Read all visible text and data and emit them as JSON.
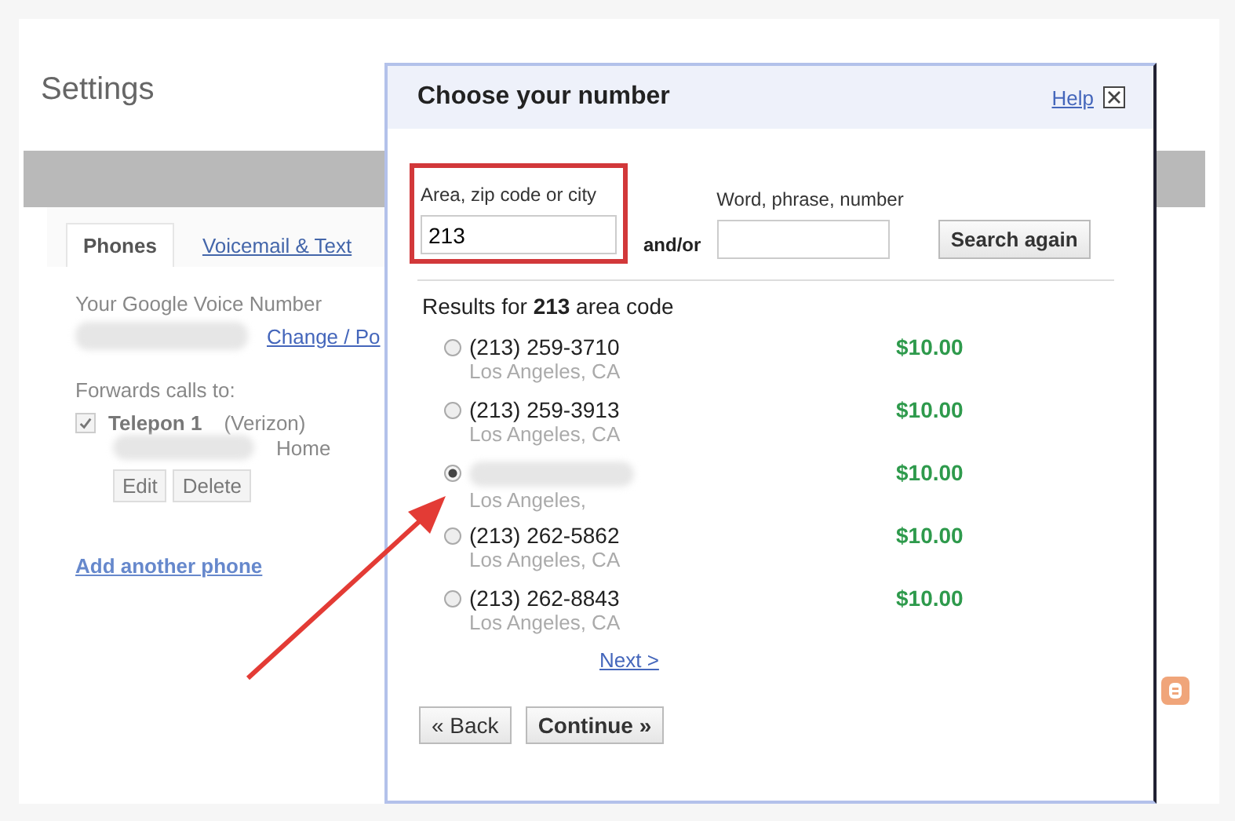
{
  "settings": {
    "title": "Settings",
    "tabs": [
      {
        "label": "Phones",
        "selected": true
      },
      {
        "label": "Voicemail & Text",
        "selected": false
      }
    ],
    "number_label": "Your Google Voice Number",
    "change_link": "Change / Po",
    "forwards_label": "Forwards calls to:",
    "phones": [
      {
        "name": "Telepon 1",
        "carrier": "(Verizon)",
        "type": "Home",
        "checked": true
      }
    ],
    "edit_button": "Edit",
    "delete_button": "Delete",
    "add_link": "Add another phone"
  },
  "dialog": {
    "title": "Choose your number",
    "help": "Help",
    "area_label": "Area, zip code or city",
    "area_value": "213",
    "and_or": "and/or",
    "word_label": "Word, phrase, number",
    "search_button": "Search again",
    "results": "Results for **213** area code",
    "numbers": [
      {
        "number": "(213) 259-3710",
        "city": "Los Angeles, CA",
        "price": "$10.00",
        "selected": false
      },
      {
        "number": "(213) 259-3913",
        "city": "Los Angeles, CA",
        "price": "$10.00",
        "selected": false
      },
      {
        "city": "Los Angeles,",
        "price": "$10.00",
        "selected": true
      },
      {
        "number": "(213) 262-5862",
        "city": "Los Angeles, CA",
        "price": "$10.00",
        "selected": false
      },
      {
        "number": "(213) 262-8843",
        "city": "Los Angeles, CA",
        "price": "$10.00",
        "selected": false
      }
    ],
    "next": "Next >",
    "back": "« Back",
    "continue": "Continue »"
  }
}
